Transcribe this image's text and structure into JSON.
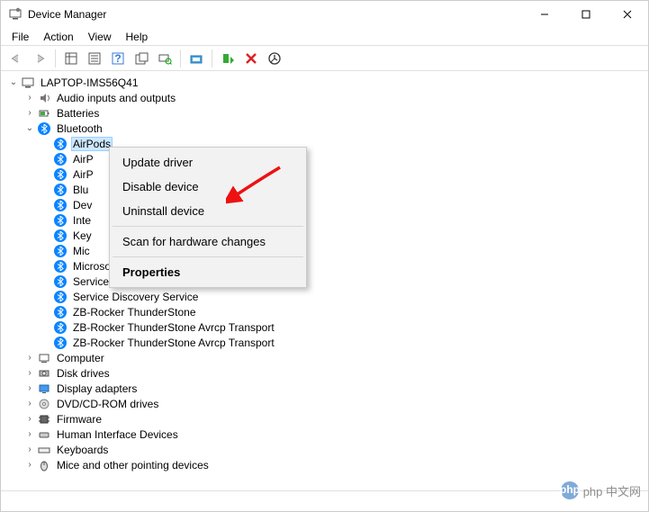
{
  "window": {
    "title": "Device Manager"
  },
  "menubar": [
    "File",
    "Action",
    "View",
    "Help"
  ],
  "root": "LAPTOP-IMS56Q41",
  "categories": {
    "audio": "Audio inputs and outputs",
    "batteries": "Batteries",
    "bluetooth": "Bluetooth",
    "computer": "Computer",
    "disk": "Disk drives",
    "display": "Display adapters",
    "dvd": "DVD/CD-ROM drives",
    "firmware": "Firmware",
    "hid": "Human Interface Devices",
    "keyboards": "Keyboards",
    "mice": "Mice and other pointing devices"
  },
  "bt": {
    "items": [
      "AirPods",
      "AirP",
      "AirP",
      "Blu",
      "Dev",
      "Inte",
      "Key",
      "Mic",
      "Microsoft Bluetooth LE Enumerator",
      "Service Discovery Service",
      "Service Discovery Service",
      "ZB-Rocker ThunderStone",
      "ZB-Rocker ThunderStone Avrcp Transport",
      "ZB-Rocker ThunderStone Avrcp Transport"
    ]
  },
  "context_menu": {
    "update": "Update driver",
    "disable": "Disable device",
    "uninstall": "Uninstall device",
    "scan": "Scan for hardware changes",
    "properties": "Properties"
  },
  "watermark": {
    "text": "php 中文网"
  }
}
